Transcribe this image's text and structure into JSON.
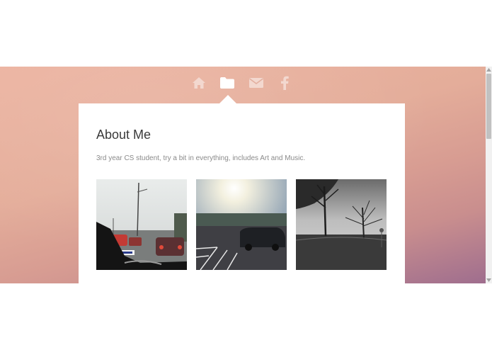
{
  "nav": {
    "items": [
      {
        "icon": "home-icon"
      },
      {
        "icon": "folder-icon",
        "active": true
      },
      {
        "icon": "envelope-icon"
      },
      {
        "icon": "facebook-icon"
      }
    ],
    "icon_color": "#f3d8cf",
    "active_color": "#ffffff"
  },
  "about": {
    "title": "About Me",
    "description": "3rd year CS student, try a bit in everything, includes Art and Music."
  },
  "photos": [
    {
      "subject": "rainy car windshield traffic"
    },
    {
      "subject": "sunny parking lot"
    },
    {
      "subject": "black and white trees"
    }
  ],
  "colors": {
    "gradient_top": "#ecb3a0",
    "gradient_bottom": "#9e6d8e",
    "panel": "#ffffff"
  }
}
